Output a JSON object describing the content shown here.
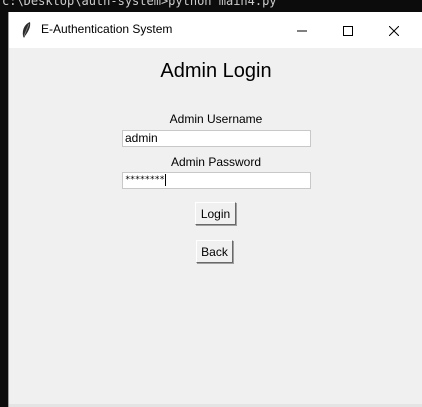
{
  "terminal": {
    "text": "c:\\Desktop\\auth-system>python main4.py"
  },
  "window": {
    "title": "E-Authentication System",
    "app_icon": "feather-icon",
    "controls": {
      "minimize": "minimize-icon",
      "maximize": "maximize-icon",
      "close": "close-icon"
    }
  },
  "form": {
    "heading": "Admin Login",
    "username_label": "Admin Username",
    "username_value": "admin",
    "password_label": "Admin Password",
    "password_value": "********",
    "login_label": "Login",
    "back_label": "Back"
  }
}
